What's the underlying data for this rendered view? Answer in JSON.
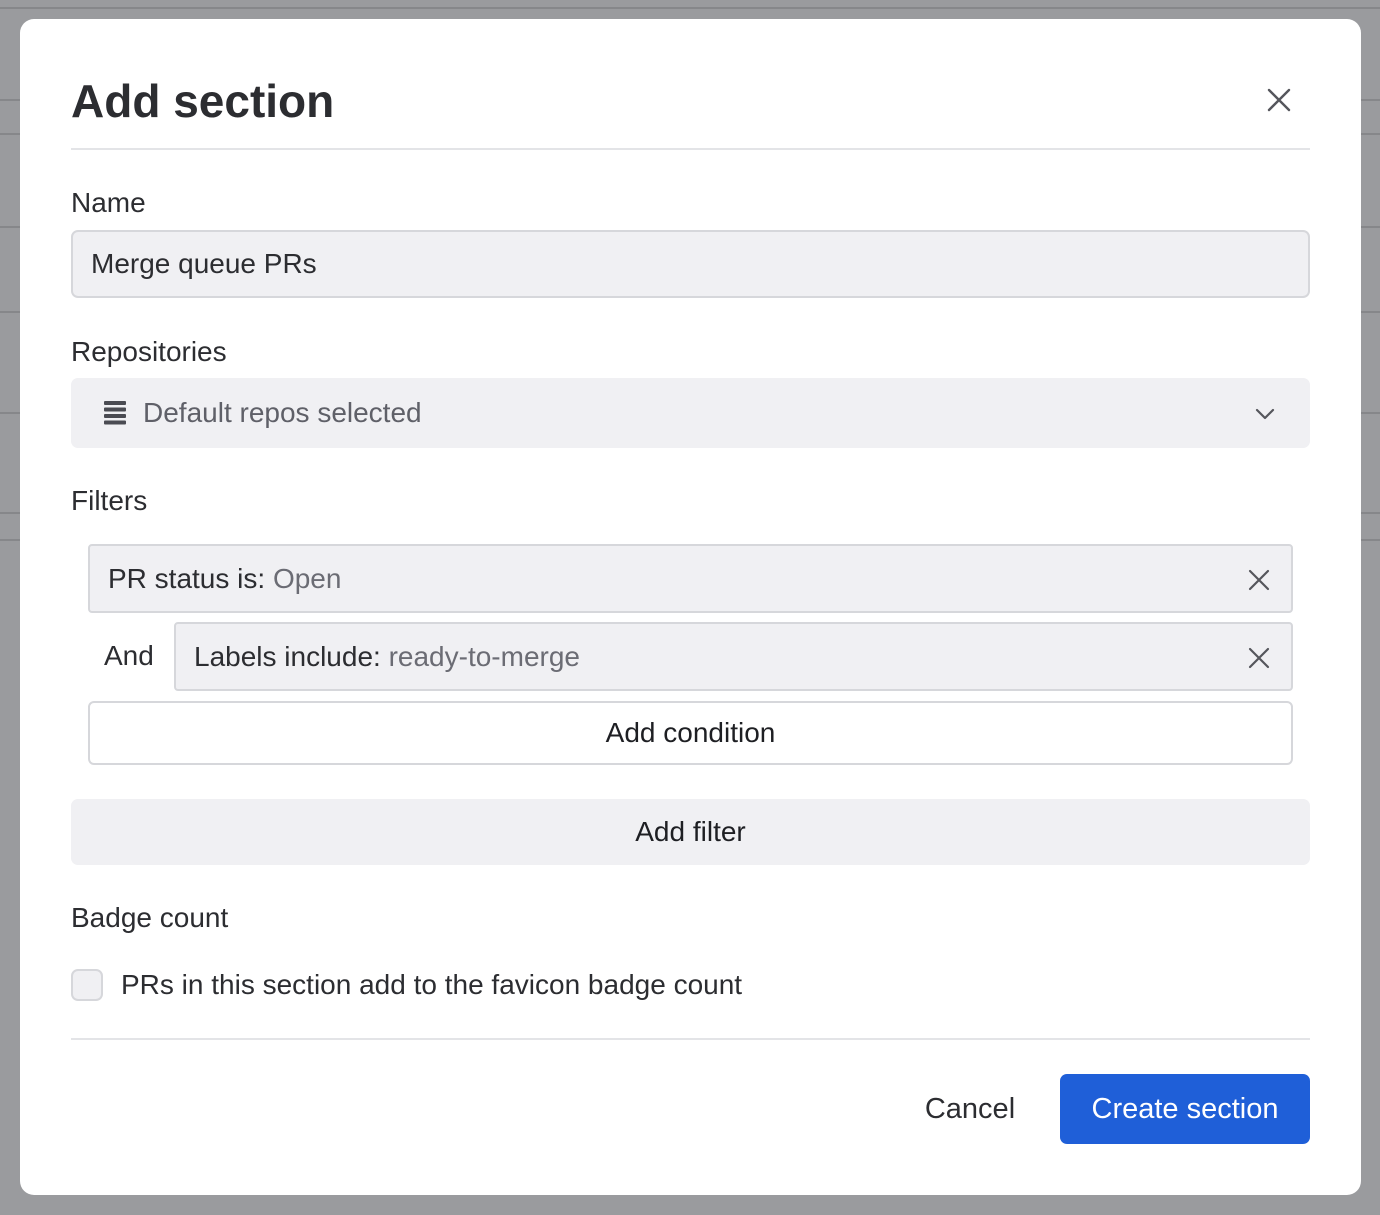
{
  "dialog": {
    "title": "Add section"
  },
  "name_field": {
    "label": "Name",
    "value": "Merge queue PRs"
  },
  "repositories": {
    "label": "Repositories",
    "selected": "Default repos selected",
    "icon": "list-icon"
  },
  "filters": {
    "label": "Filters",
    "conditions": [
      {
        "key": "PR status is: ",
        "value": "Open"
      },
      {
        "connector": "And",
        "key": "Labels include: ",
        "value": "ready-to-merge"
      }
    ],
    "add_condition_label": "Add condition",
    "add_filter_label": "Add filter"
  },
  "badge_count": {
    "label": "Badge count",
    "checkbox_label": "PRs in this section add to the favicon badge count",
    "checked": false
  },
  "footer": {
    "cancel_label": "Cancel",
    "create_label": "Create section"
  },
  "colors": {
    "primary": "#1f5fd8",
    "field_bg": "#f0f0f3",
    "overlay": "#8f9093"
  }
}
